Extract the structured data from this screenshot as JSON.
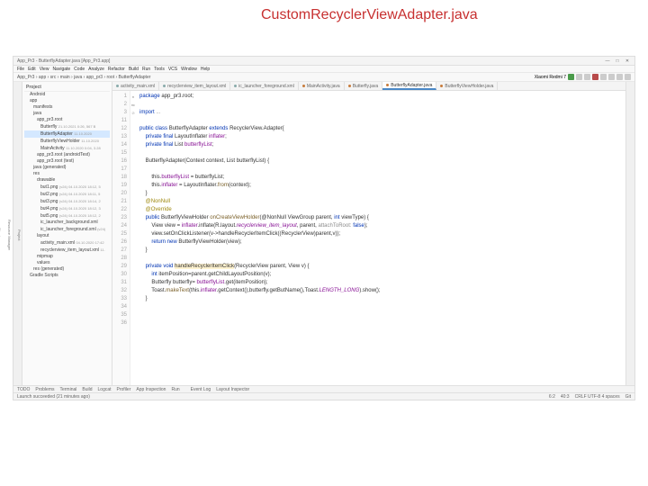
{
  "annotation": "CustomRecyclerViewAdapter.java",
  "title": "App_Pr3 - ButterflyAdapter.java [App_Pr3.app]",
  "menu": [
    "File",
    "Edit",
    "View",
    "Navigate",
    "Code",
    "Analyze",
    "Refactor",
    "Build",
    "Run",
    "Tools",
    "VCS",
    "Window",
    "Help"
  ],
  "breadcrumb": "App_Pr3 › app › src › main › java › app_pr3 › root › ButterflyAdapter",
  "device": "Xiaomi Redmi 7",
  "tree": {
    "header": "Project",
    "items": [
      {
        "l": 0,
        "t": "Android"
      },
      {
        "l": 1,
        "t": "app"
      },
      {
        "l": 2,
        "t": "manifests"
      },
      {
        "l": 2,
        "t": "java"
      },
      {
        "l": 3,
        "t": "app_pr3.root"
      },
      {
        "l": 4,
        "t": "Butterfly",
        "m": "21.10.2021 0:26, 567 B"
      },
      {
        "l": 4,
        "t": "ButterflyAdapter",
        "m": "11.10.2020",
        "sel": true
      },
      {
        "l": 4,
        "t": "ButterflyViewHolder",
        "m": "11.10.2020"
      },
      {
        "l": 4,
        "t": "MainActivity",
        "m": "11.10.2020 0:04, 3.28"
      },
      {
        "l": 3,
        "t": "app_pr3.root (androidTest)"
      },
      {
        "l": 3,
        "t": "app_pr3.root (test)"
      },
      {
        "l": 2,
        "t": "java (generated)"
      },
      {
        "l": 2,
        "t": "res"
      },
      {
        "l": 3,
        "t": "drawable"
      },
      {
        "l": 4,
        "t": "but1.png",
        "m": "(v24) 04.10.2020 18:12, 5"
      },
      {
        "l": 4,
        "t": "but2.png",
        "m": "(v24) 04.10.2020 18:11, 5"
      },
      {
        "l": 4,
        "t": "but3.png",
        "m": "(v24) 04.10.2020 18:14, 2"
      },
      {
        "l": 4,
        "t": "but4.png",
        "m": "(v24) 04.10.2020 18:12, 3"
      },
      {
        "l": 4,
        "t": "but5.png",
        "m": "(v24) 04.10.2020 18:12, 2"
      },
      {
        "l": 4,
        "t": "ic_launcher_background.xml"
      },
      {
        "l": 4,
        "t": "ic_launcher_foreground.xml",
        "m": "(v24)"
      },
      {
        "l": 3,
        "t": "layout"
      },
      {
        "l": 4,
        "t": "activity_main.xml",
        "m": "04.10.2020 17:42"
      },
      {
        "l": 4,
        "t": "recyclerview_item_layout.xml",
        "m": "11."
      },
      {
        "l": 3,
        "t": "mipmap"
      },
      {
        "l": 3,
        "t": "values"
      },
      {
        "l": 2,
        "t": "res (generated)"
      },
      {
        "l": 1,
        "t": "Gradle Scripts"
      }
    ]
  },
  "tabs": [
    {
      "label": "activity_main.xml",
      "kind": "x"
    },
    {
      "label": "recyclerview_item_layout.xml",
      "kind": "x"
    },
    {
      "label": "ic_launcher_foreground.xml",
      "kind": "x"
    },
    {
      "label": "MainActivity.java",
      "kind": "j"
    },
    {
      "label": "Butterfly.java",
      "kind": "j"
    },
    {
      "label": "ButterflyAdapter.java",
      "kind": "j",
      "active": true
    },
    {
      "label": "ButterflyViewHolder.java",
      "kind": "j"
    }
  ],
  "code": {
    "lines": [
      1,
      2,
      3,
      11,
      12,
      13,
      14,
      15,
      16,
      17,
      18,
      19,
      20,
      21,
      22,
      23,
      24,
      25,
      26,
      27,
      28,
      29,
      30,
      31,
      32,
      33,
      34,
      35,
      36
    ],
    "marks": {
      "14": "●",
      "26": "●▸",
      "31": "⊘"
    },
    "l1": "package app_pr3.root;",
    "l3": "import ...",
    "l14_a": "public class ",
    "l14_b": "ButterflyAdapter ",
    "l14_c": "extends ",
    "l14_d": "RecyclerView.Adapter<ButterflyViewHolder>{",
    "l15_a": "    private final ",
    "l15_b": "LayoutInflater ",
    "l15_c": "inflater",
    ";": ";",
    "l16_a": "    private final ",
    "l16_b": "List<Butterfly> ",
    "l16_c": "butterflyList",
    "l18": "    ButterflyAdapter(Context context, List<Butterfly> butterflyList) {",
    "l20_a": "        this.",
    "l20_b": "butterflyList",
    "l20_c": " = butterflyList;",
    "l21_a": "        this.",
    "l21_b": "inflater",
    "l21_c": " = LayoutInflater.",
    "l21_d": "from",
    "l21_e": "(context);",
    "l22": "    }",
    "l23": "    @NonNull",
    "l24": "    @Override",
    "l26_a": "    public ",
    "l26_b": "ButterflyViewHolder ",
    "l26_c": "onCreateViewHolder",
    "l26_d": "(@NonNull ViewGroup parent, ",
    "l26_e": "int ",
    "l26_f": "viewType) {",
    "l27_a": "        View view = ",
    "l27_b": "inflater",
    "l27_c": ".inflate(R.layout.",
    "l27_d": "recyclerview_item_layout",
    "l27_e": ", parent, ",
    "l27_f": "attachToRoot:",
    "l27_g": " false",
    ");": ");",
    "l28": "        view.setOnClickListener(v->handleRecyclerItemClick((RecyclerView)parent,v));",
    "l29_a": "        return new ",
    "l29_b": "ButterflyViewHolder(view);",
    "l30": "    }",
    "l32_a": "    private void ",
    "l32_b": "handleRecyclerItemClick",
    "l32_c": "(RecyclerView parent, View v) {",
    "l33_a": "        int ",
    "l33_b": "itemPosition=parent.getChildLayoutPosition(v);",
    "l34_a": "        Butterfly butterfly= ",
    "l34_b": "butterflyList",
    "l34_c": ".get(itemPosition);",
    "l35_a": "        Toast.",
    "l35_b": "makeText",
    "l35_c": "(this.",
    "l35_d": "inflater",
    "l35_e": ".getContext(),butterfly.getButName(),Toast.",
    "l35_f": "LENGTH_LONG",
    "l35_g": ").show();",
    "l36": "    }"
  },
  "status": {
    "left": "Launch succeeded (21 minutes ago)",
    "indicators": "6:2",
    "right1": "Event Log",
    "right2": "Layout Inspector",
    "pos": "40:3",
    "enc": "CRLF  UTF-8  4 spaces",
    "git": "Git"
  },
  "bottom_tabs": [
    "TODO",
    "Problems",
    "Terminal",
    "Build",
    "Logcat",
    "Profiler",
    "App Inspection",
    "Run"
  ]
}
